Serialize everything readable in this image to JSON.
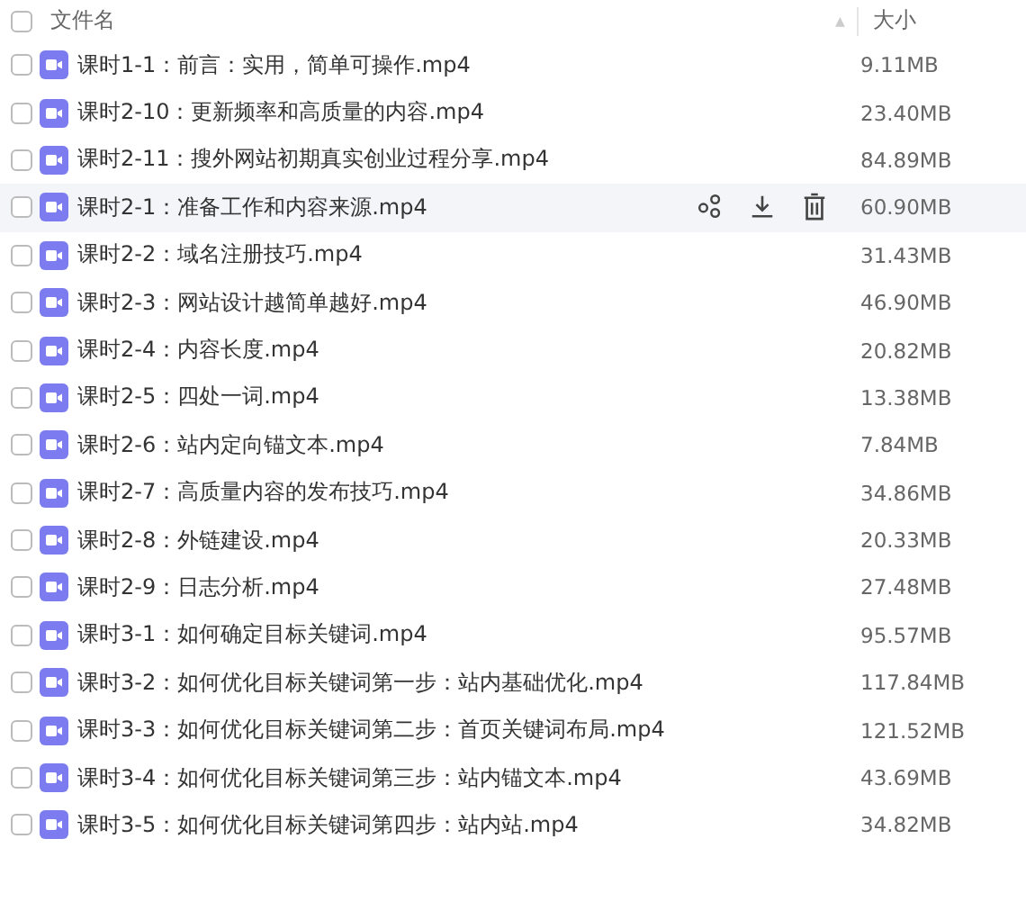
{
  "header": {
    "checked": false,
    "name_column": "文件名",
    "sort_mark": "▲",
    "size_column": "大小"
  },
  "files": [
    {
      "name": "课时1-1：前言：实用，简单可操作.mp4",
      "size": "9.11MB",
      "checked": false,
      "highlighted": false
    },
    {
      "name": "课时2-10：更新频率和高质量的内容.mp4",
      "size": "23.40MB",
      "checked": false,
      "highlighted": false
    },
    {
      "name": "课时2-11：搜外网站初期真实创业过程分享.mp4",
      "size": "84.89MB",
      "checked": false,
      "highlighted": false
    },
    {
      "name": "课时2-1：准备工作和内容来源.mp4",
      "size": "60.90MB",
      "checked": false,
      "highlighted": true
    },
    {
      "name": "课时2-2：域名注册技巧.mp4",
      "size": "31.43MB",
      "checked": false,
      "highlighted": false
    },
    {
      "name": "课时2-3：网站设计越简单越好.mp4",
      "size": "46.90MB",
      "checked": false,
      "highlighted": false
    },
    {
      "name": "课时2-4：内容长度.mp4",
      "size": "20.82MB",
      "checked": false,
      "highlighted": false
    },
    {
      "name": "课时2-5：四处一词.mp4",
      "size": "13.38MB",
      "checked": false,
      "highlighted": false
    },
    {
      "name": "课时2-6：站内定向锚文本.mp4",
      "size": "7.84MB",
      "checked": false,
      "highlighted": false
    },
    {
      "name": "课时2-7：高质量内容的发布技巧.mp4",
      "size": "34.86MB",
      "checked": false,
      "highlighted": false
    },
    {
      "name": "课时2-8：外链建设.mp4",
      "size": "20.33MB",
      "checked": false,
      "highlighted": false
    },
    {
      "name": "课时2-9：日志分析.mp4",
      "size": "27.48MB",
      "checked": false,
      "highlighted": false
    },
    {
      "name": "课时3-1：如何确定目标关键词.mp4",
      "size": "95.57MB",
      "checked": false,
      "highlighted": false
    },
    {
      "name": "课时3-2：如何优化目标关键词第一步：站内基础优化.mp4",
      "size": "117.84MB",
      "checked": false,
      "highlighted": false
    },
    {
      "name": "课时3-3：如何优化目标关键词第二步：首页关键词布局.mp4",
      "size": "121.52MB",
      "checked": false,
      "highlighted": false
    },
    {
      "name": "课时3-4：如何优化目标关键词第三步：站内锚文本.mp4",
      "size": "43.69MB",
      "checked": false,
      "highlighted": false
    },
    {
      "name": "课时3-5：如何优化目标关键词第四步：站内站.mp4",
      "size": "34.82MB",
      "checked": false,
      "highlighted": false
    }
  ]
}
